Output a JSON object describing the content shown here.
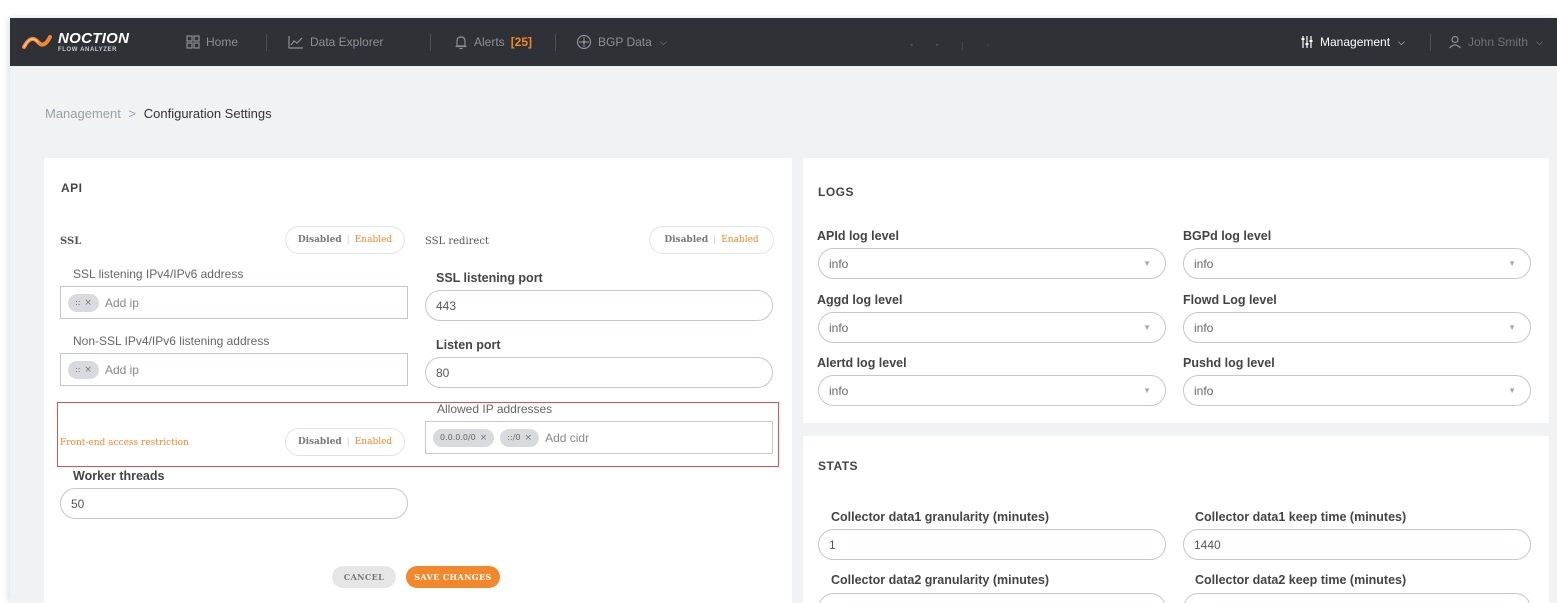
{
  "nav": {
    "logo_main": "NOCTION",
    "logo_sub": "FLOW ANALYZER",
    "home": "Home",
    "data_explorer": "Data Explorer",
    "alerts": "Alerts",
    "alerts_count": "[25]",
    "bgp_data": "BGP Data",
    "management": "Management",
    "user": "John Smith",
    "accent_color": "#f3872b",
    "bg_color": "#2e3136"
  },
  "breadcrumb": {
    "parent": "Management",
    "separator": ">",
    "current": "Configuration Settings"
  },
  "api": {
    "title": "API",
    "ssl_label": "SSL",
    "ssl_toggle": {
      "off": "Disabled",
      "on": "Enabled",
      "selected": "Enabled"
    },
    "ssl_redirect_label": "SSL redirect",
    "ssl_redirect_toggle": {
      "off": "Disabled",
      "on": "Enabled",
      "selected": "Enabled"
    },
    "ssl_listen_addr_label": "SSL listening IPv4/IPv6 address",
    "ssl_listen_addr_chips": [
      "::"
    ],
    "ssl_listen_addr_placeholder": "Add ip",
    "ssl_port_label": "SSL listening port",
    "ssl_port_value": "443",
    "nonssl_addr_label": "Non-SSL IPv4/IPv6 listening address",
    "nonssl_addr_chips": [
      "::"
    ],
    "nonssl_addr_placeholder": "Add ip",
    "listen_port_label": "Listen port",
    "listen_port_value": "80",
    "frontend_label": "Front-end access restriction",
    "frontend_toggle": {
      "off": "Disabled",
      "on": "Enabled",
      "selected": "Enabled"
    },
    "allowed_ip_label": "Allowed IP addresses",
    "allowed_ip_chips": [
      "0.0.0.0/0",
      "::/0"
    ],
    "allowed_ip_placeholder": "Add cidr",
    "worker_threads_label": "Worker threads",
    "worker_threads_value": "50",
    "cancel_label": "CANCEL",
    "save_label": "SAVE CHANGES"
  },
  "logs": {
    "title": "LOGS",
    "apid_label": "APId log level",
    "apid_value": "info",
    "bgpd_label": "BGPd log level",
    "bgpd_value": "info",
    "aggd_label": "Aggd log level",
    "aggd_value": "info",
    "flowd_label": "Flowd Log level",
    "flowd_value": "info",
    "alertd_label": "Alertd log level",
    "alertd_value": "info",
    "pushd_label": "Pushd log level",
    "pushd_value": "info"
  },
  "stats": {
    "title": "STATS",
    "c1_gran_label": "Collector data1 granularity (minutes)",
    "c1_gran_value": "1",
    "c1_keep_label": "Collector data1 keep time (minutes)",
    "c1_keep_value": "1440",
    "c2_gran_label": "Collector data2 granularity (minutes)",
    "c2_keep_label": "Collector data2 keep time (minutes)"
  }
}
